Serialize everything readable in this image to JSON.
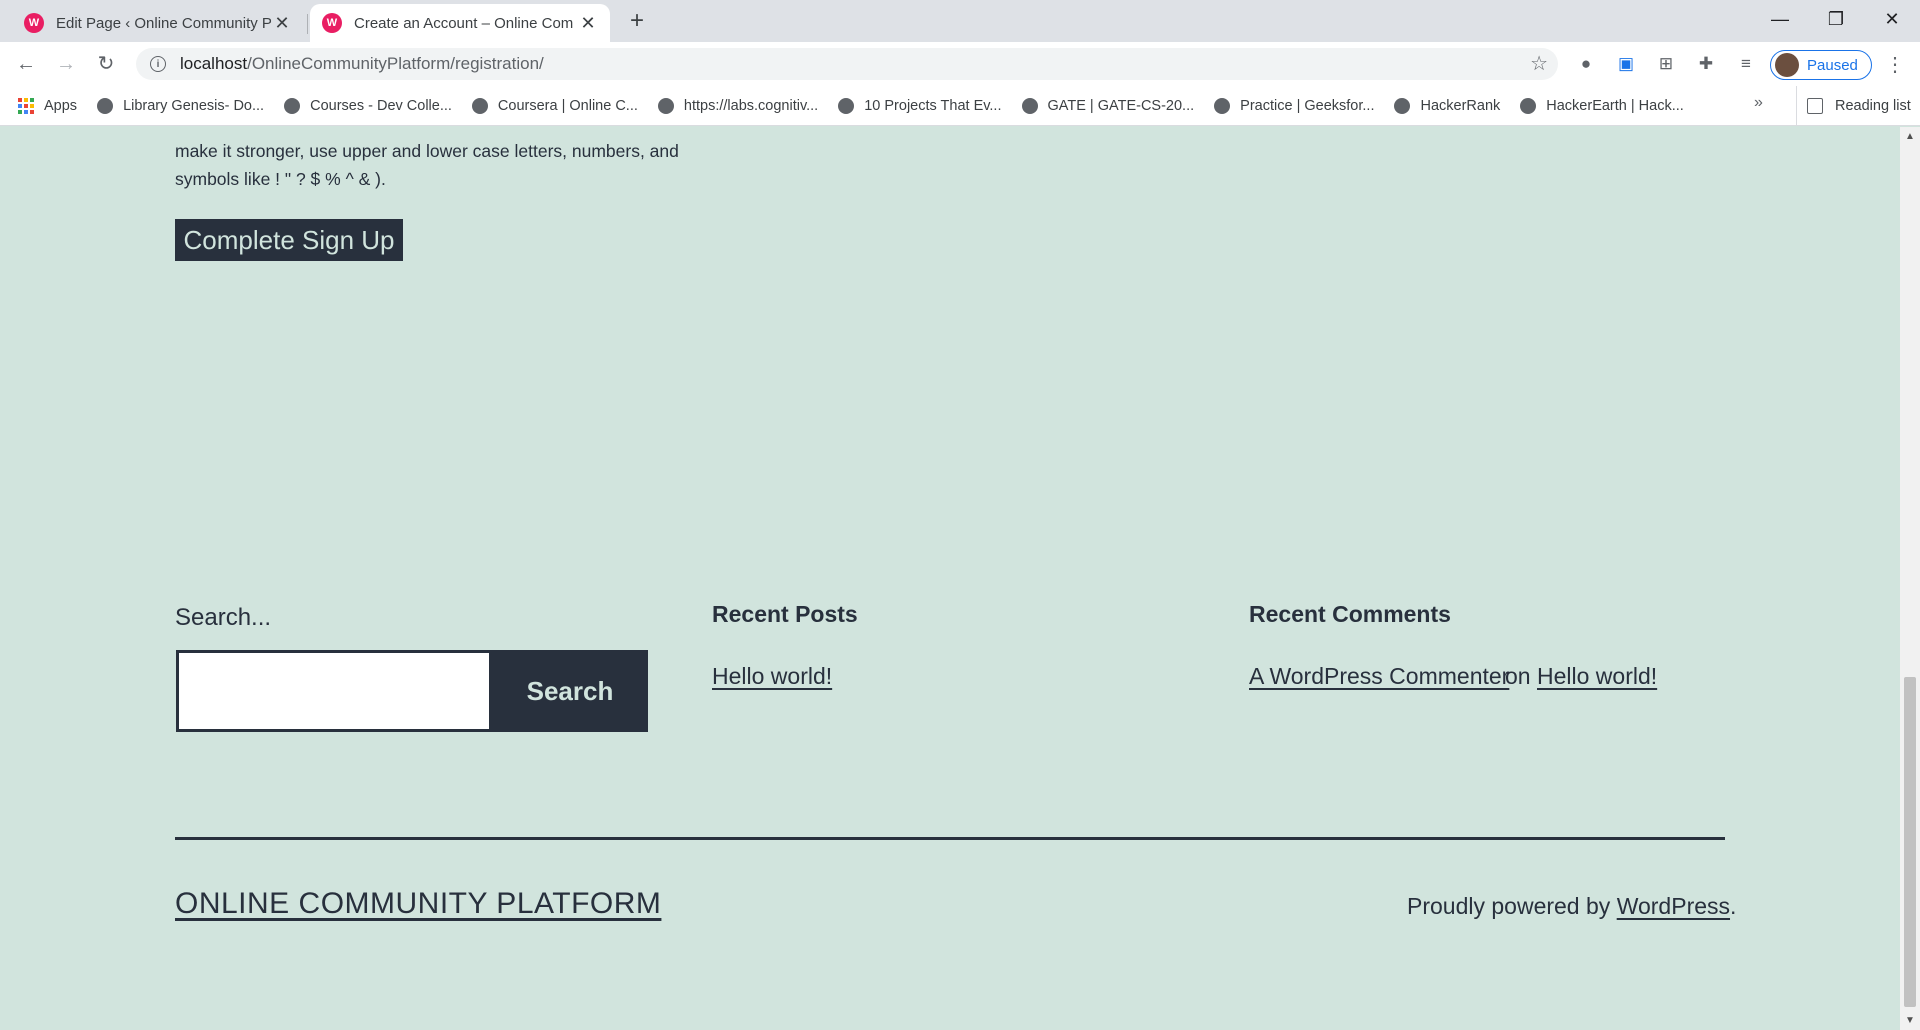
{
  "browser": {
    "tabs": [
      {
        "title": "Edit Page ‹ Online Community Pl",
        "favicon": "wordpress-local-icon"
      },
      {
        "title": "Create an Account – Online Com",
        "favicon": "wordpress-local-icon"
      }
    ],
    "url_host": "localhost",
    "url_path": "/OnlineCommunityPlatform/registration/",
    "profile_label": "Paused",
    "bookmarks": [
      "Apps",
      "Library Genesis- Do...",
      "Courses - Dev Colle...",
      "Coursera | Online C...",
      "https://labs.cognitiv...",
      "10 Projects That Ev...",
      "GATE | GATE-CS-20...",
      "Practice | Geeksfor...",
      "HackerRank",
      "HackerEarth | Hack..."
    ],
    "more_bookmarks": "»",
    "reading_list": "Reading list"
  },
  "page": {
    "password_hint_line1": "make it stronger, use upper and lower case letters, numbers, and",
    "password_hint_line2": "symbols like ! \" ? $ % ^ & ).",
    "signup_button": "Complete Sign Up",
    "search_widget": {
      "label": "Search...",
      "input_value": "",
      "button": "Search"
    },
    "recent_posts": {
      "title": "Recent Posts",
      "items": [
        "Hello world!"
      ]
    },
    "recent_comments": {
      "title": "Recent Comments",
      "author": "A WordPress Commenter",
      "connector": "on",
      "post": "Hello world!"
    },
    "footer": {
      "site_name": "ONLINE COMMUNITY PLATFORM",
      "powered_prefix": "Proudly powered by ",
      "powered_link": "WordPress",
      "powered_suffix": "."
    }
  },
  "colors": {
    "page_background": "#d1e4dd",
    "text_dark": "#28303d",
    "wordpress_pink": "#e91e63",
    "profile_blue": "#1a73e8"
  }
}
